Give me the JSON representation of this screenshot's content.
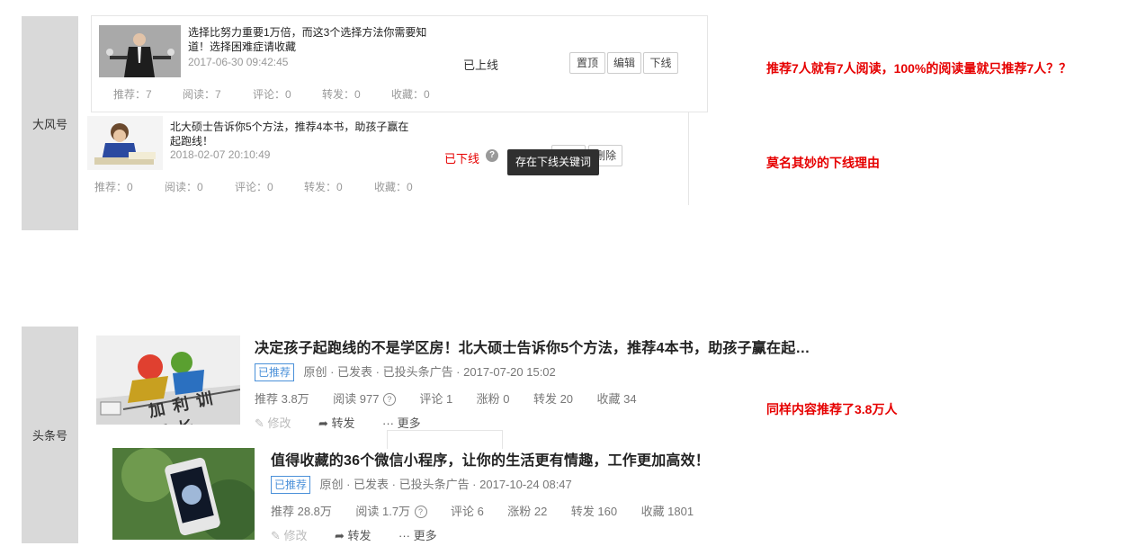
{
  "dafeng": {
    "label": "大风号",
    "article1": {
      "title": "选择比努力重要1万倍，而这3个选择方法你需要知道！选择困难症请收藏",
      "timestamp": "2017-06-30 09:42:45",
      "status": "已上线",
      "buttons": {
        "pin": "置顶",
        "edit": "编辑",
        "offline": "下线"
      },
      "stats": {
        "recommend": "推荐：7",
        "read": "阅读：7",
        "comment": "评论：0",
        "repost": "转发：0",
        "favorite": "收藏：0"
      }
    },
    "article2": {
      "title": "北大硕士告诉你5个方法，推荐4本书，助孩子赢在起跑线！",
      "timestamp": "2018-02-07 20:10:49",
      "status": "已下线",
      "tooltip": "存在下线关键词",
      "delete_button": "删除",
      "stats": {
        "recommend": "推荐：0",
        "read": "阅读：0",
        "comment": "评论：0",
        "repost": "转发：0",
        "favorite": "收藏：0"
      }
    },
    "note1": "推荐7人就有7人阅读，100%的阅读量就只推荐7人？？",
    "note2": "莫名其妙的下线理由"
  },
  "toutiao": {
    "label": "头条号",
    "article1": {
      "title": "决定孩子起跑线的不是学区房！北大硕士告诉你5个方法，推荐4本书，助孩子赢在起…",
      "badge": "已推荐",
      "meta": "原创 · 已发表 · 已投头条广告 · 2017-07-20 15:02",
      "stats": {
        "recommend": "推荐 3.8万",
        "read": "阅读 977",
        "comment": "评论 1",
        "fans": "涨粉 0",
        "repost": "转发 20",
        "favorite": "收藏 34"
      },
      "actions": {
        "edit": "修改",
        "repost": "转发",
        "more": "更多"
      },
      "thumb_text": "加 利 训 课 长"
    },
    "article2": {
      "title": "值得收藏的36个微信小程序，让你的生活更有情趣，工作更加高效！",
      "badge": "已推荐",
      "meta": "原创 · 已发表 · 已投头条广告 · 2017-10-24 08:47",
      "stats": {
        "recommend": "推荐 28.8万",
        "read": "阅读 1.7万",
        "comment": "评论 6",
        "fans": "涨粉 22",
        "repost": "转发 160",
        "favorite": "收藏 1801"
      },
      "actions": {
        "edit": "修改",
        "repost": "转发",
        "more": "更多"
      }
    },
    "note": "同样内容推荐了3.8万人"
  },
  "colors": {
    "note_red": "#e60000",
    "badge_blue": "#4a90d9",
    "side_gray": "#d9d9d9"
  }
}
